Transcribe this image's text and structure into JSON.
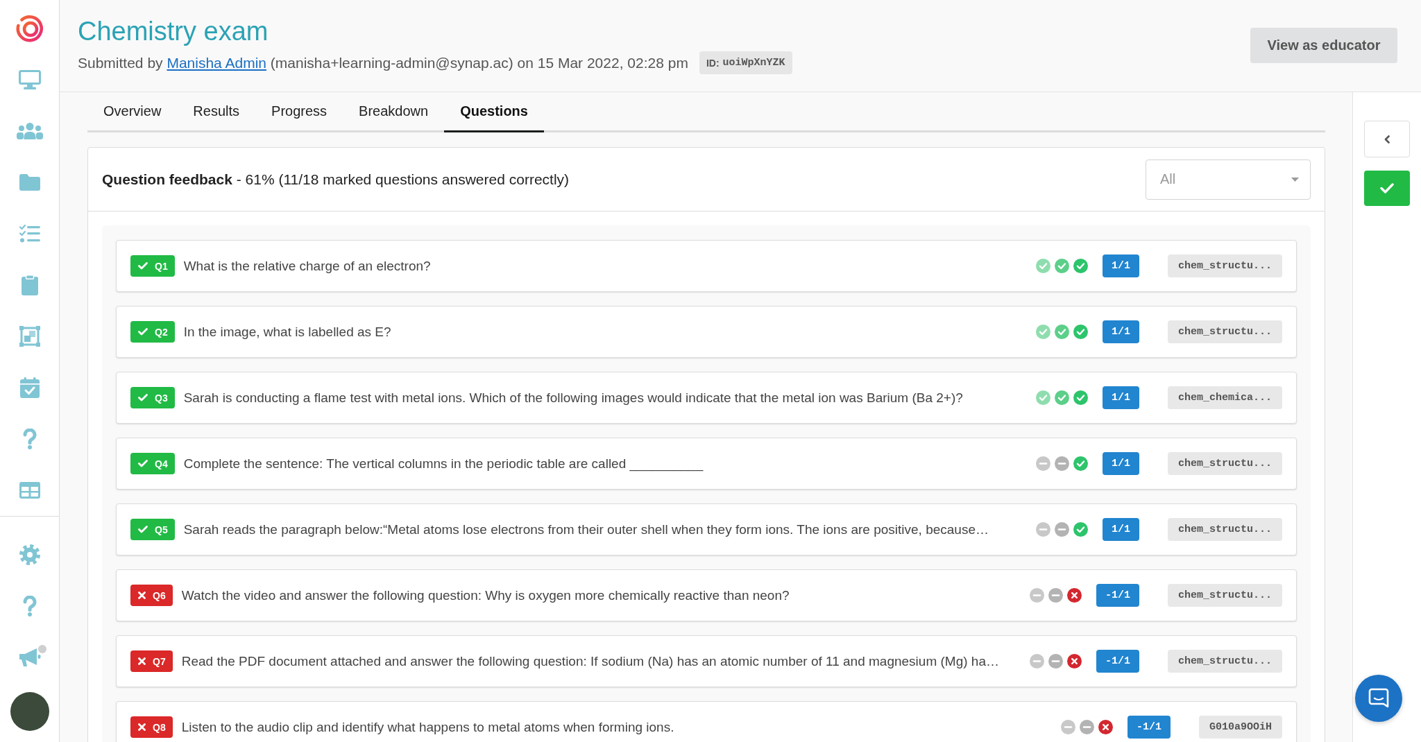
{
  "sidebar": {
    "notification_dot": true
  },
  "header": {
    "title": "Chemistry exam",
    "submitted_prefix": "Submitted by",
    "author": "Manisha Admin",
    "submitted_suffix": "(manisha+learning-admin@synap.ac) on 15 Mar 2022, 02:28 pm",
    "id_label": "ID:",
    "id_value": "uoiWpXnYZK",
    "action_button": "View as educator"
  },
  "tabs": [
    {
      "label": "Overview",
      "selected": false
    },
    {
      "label": "Results",
      "selected": false
    },
    {
      "label": "Progress",
      "selected": false
    },
    {
      "label": "Breakdown",
      "selected": false
    },
    {
      "label": "Questions",
      "selected": true
    }
  ],
  "feedback": {
    "summary": "**Question feedback** - 61% (11/18 marked questions answered correctly)",
    "filter": {
      "value": "All"
    }
  },
  "questions": [
    {
      "number": "Q1",
      "correct": true,
      "text": "What is the relative charge of an electron?",
      "attempts": [
        {
          "kind": "correct"
        },
        {
          "kind": "correct"
        },
        {
          "kind": "correct"
        }
      ],
      "score": "1/1",
      "tag": "chem_structu..."
    },
    {
      "number": "Q2",
      "correct": true,
      "text": "In the image, what is labelled as E?",
      "attempts": [
        {
          "kind": "correct"
        },
        {
          "kind": "correct"
        },
        {
          "kind": "correct"
        }
      ],
      "score": "1/1",
      "tag": "chem_structu..."
    },
    {
      "number": "Q3",
      "correct": true,
      "text": "Sarah is conducting a flame test with metal ions. Which of the following images would indicate that the metal ion was Barium (Ba 2+)?",
      "attempts": [
        {
          "kind": "correct"
        },
        {
          "kind": "correct"
        },
        {
          "kind": "correct"
        }
      ],
      "score": "1/1",
      "tag": "chem_chemica..."
    },
    {
      "number": "Q4",
      "correct": true,
      "text": "Complete the sentence: The vertical columns in the periodic table are called __________",
      "attempts": [
        {
          "kind": "skipped"
        },
        {
          "kind": "skipped"
        },
        {
          "kind": "correct"
        }
      ],
      "score": "1/1",
      "tag": "chem_structu..."
    },
    {
      "number": "Q5",
      "correct": true,
      "text": "Sarah reads the paragraph below:“Metal atoms lose electrons from their outer shell when they form ions. The ions are positive, because…",
      "attempts": [
        {
          "kind": "skipped"
        },
        {
          "kind": "skipped"
        },
        {
          "kind": "correct"
        }
      ],
      "score": "1/1",
      "tag": "chem_structu..."
    },
    {
      "number": "Q6",
      "correct": false,
      "text": "Watch the video and answer the following question: Why is oxygen more chemically reactive than neon?",
      "attempts": [
        {
          "kind": "skipped"
        },
        {
          "kind": "skipped"
        },
        {
          "kind": "incorrect"
        }
      ],
      "score": "-1/1",
      "tag": "chem_structu..."
    },
    {
      "number": "Q7",
      "correct": false,
      "text": "Read the PDF document attached and answer the following question: If sodium (Na) has an atomic number of 11 and magnesium (Mg) ha…",
      "attempts": [
        {
          "kind": "skipped"
        },
        {
          "kind": "skipped"
        },
        {
          "kind": "incorrect"
        }
      ],
      "score": "-1/1",
      "tag": "chem_structu..."
    },
    {
      "number": "Q8",
      "correct": false,
      "text": "Listen to the audio clip and identify what happens to metal atoms when forming ions.",
      "attempts": [
        {
          "kind": "skipped"
        },
        {
          "kind": "skipped"
        },
        {
          "kind": "incorrect"
        }
      ],
      "score": "-1/1",
      "tag": "G010a9OOiH"
    }
  ]
}
